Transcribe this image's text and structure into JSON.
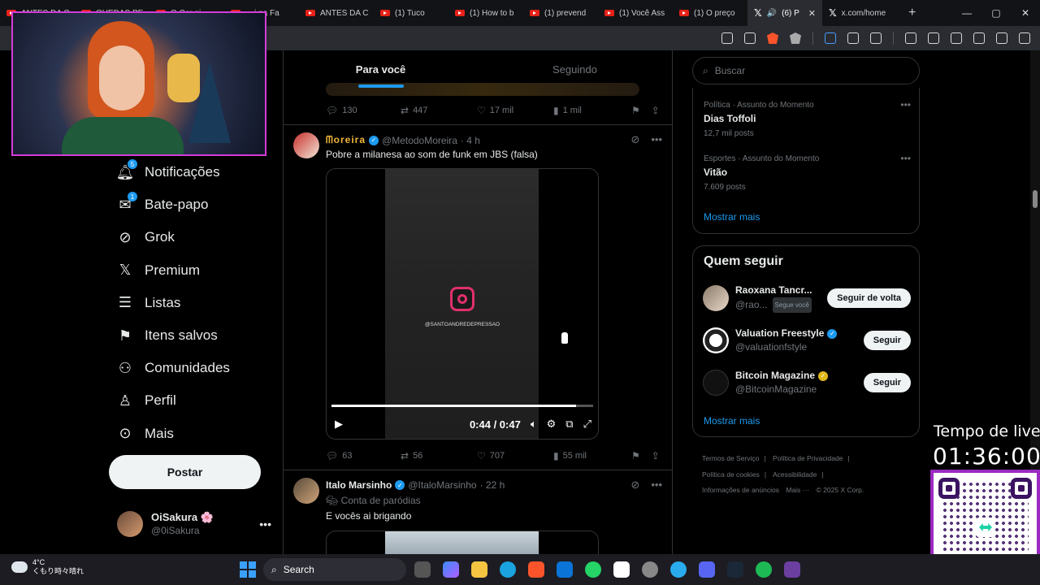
{
  "browser": {
    "tabs": [
      {
        "label": "ANTES DA C",
        "type": "youtube"
      },
      {
        "label": "QUEDAS PE",
        "type": "youtube"
      },
      {
        "label": "O Cor ni",
        "type": "youtube"
      },
      {
        "label": "... i na Fa",
        "type": "youtube"
      },
      {
        "label": "ANTES DA C",
        "type": "youtube"
      },
      {
        "label": "(1) Tuco",
        "type": "youtube"
      },
      {
        "label": "(1) How to b",
        "type": "youtube"
      },
      {
        "label": "(1) prevend",
        "type": "youtube"
      },
      {
        "label": "(1) Você Ass",
        "type": "youtube"
      },
      {
        "label": "(1) O preço",
        "type": "youtube"
      },
      {
        "label": "(6) P",
        "type": "x",
        "active": true
      },
      {
        "label": "x.com/home",
        "type": "x"
      }
    ],
    "new_tab": "+",
    "window_controls": [
      "—",
      "▢",
      "✕"
    ]
  },
  "feed": {
    "tabs": [
      "Para você",
      "Seguindo"
    ],
    "active_tab": "Para você",
    "tweet0_actions": {
      "replies": "130",
      "retweets": "447",
      "likes": "17 mil",
      "views": "1 mil"
    },
    "tweet1": {
      "name": "ᗰoreira",
      "handle": "@MetodoMoreira",
      "time": "· 4 h",
      "text": "Pobre a milanesa ao som de funk em JBS (falsa)",
      "video_handle": "@SANTOANDREDEPRESSAO",
      "video_time": "0:44 / 0:47",
      "progress": 0.935,
      "actions": {
        "replies": "63",
        "retweets": "56",
        "likes": "707",
        "views": "55 mil"
      }
    },
    "tweet2": {
      "name": "Italo Marsinho",
      "handle": "@ItaloMarsinho",
      "time": "· 22 h",
      "label": "Conta de paródias",
      "text": "E vocês ai brigando"
    }
  },
  "nav": {
    "items": [
      {
        "label": "Notificações",
        "icon": "bell-icon",
        "badge": "5"
      },
      {
        "label": "Bate-papo",
        "icon": "mail-icon",
        "badge": "1"
      },
      {
        "label": "Grok",
        "icon": "grok-icon"
      },
      {
        "label": "Premium",
        "icon": "x-icon"
      },
      {
        "label": "Listas",
        "icon": "list-icon"
      },
      {
        "label": "Itens salvos",
        "icon": "bookmark-icon"
      },
      {
        "label": "Comunidades",
        "icon": "communities-icon"
      },
      {
        "label": "Perfil",
        "icon": "user-icon"
      },
      {
        "label": "Mais",
        "icon": "more-icon"
      }
    ],
    "post_label": "Postar",
    "user": {
      "name": "OiSakura 🌸",
      "handle": "@0iSakura"
    }
  },
  "right": {
    "search_placeholder": "Buscar",
    "trends": [
      {
        "category": "Política · Assunto do Momento",
        "title": "Dias Toffoli",
        "count": "12,7 mil posts"
      },
      {
        "category": "Esportes · Assunto do Momento",
        "title": "Vitão",
        "count": "7.609 posts"
      }
    ],
    "show_more": "Mostrar mais",
    "who_to_follow_title": "Quem seguir",
    "who": [
      {
        "name": "Raoxana Tancr...",
        "handle": "@rao...",
        "tag": "Segue você",
        "button": "Seguir de volta",
        "verified": false
      },
      {
        "name": "Valuation Freestyle",
        "handle": "@valuationfstyle",
        "button": "Seguir",
        "verified": "blue"
      },
      {
        "name": "Bitcoin Magazine",
        "handle": "@BitcoinMagazine",
        "button": "Seguir",
        "verified": "gold"
      }
    ],
    "show_more_2": "Mostrar mais",
    "footer": [
      "Termos de Serviço",
      "|",
      "Política de Privacidade",
      "|",
      "Política de cookies",
      "|",
      "Acessibilidade",
      "|",
      "Informações de anúncios",
      "Mais ···",
      "© 2025 X Corp."
    ]
  },
  "overlay": {
    "live_label": "Tempo de live:",
    "live_time": "01:36:00"
  },
  "taskbar": {
    "weather_temp": "4°C",
    "weather_desc": "くもり時々晴れ",
    "search_label": "Search"
  },
  "colors": {
    "accent": "#1d9bf0",
    "background": "#000000",
    "cam_border": "#d43cd9",
    "qr_border": "#9b2ac2"
  }
}
